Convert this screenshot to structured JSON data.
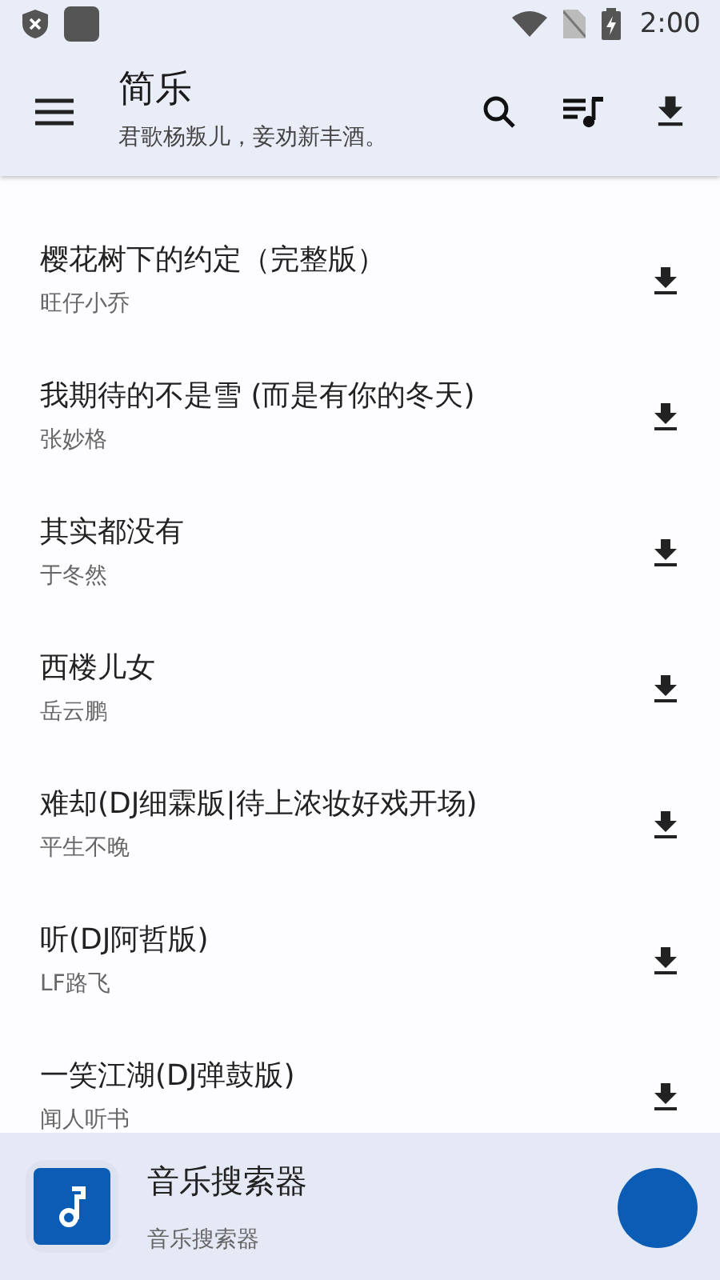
{
  "status_bar": {
    "time": "2:00"
  },
  "app_bar": {
    "title": "简乐",
    "subtitle": "君歌杨叛儿，妾劝新丰酒。"
  },
  "songs": [
    {
      "title": "樱花树下的约定（完整版）",
      "artist": "旺仔小乔"
    },
    {
      "title": "我期待的不是雪 (而是有你的冬天)",
      "artist": "张妙格"
    },
    {
      "title": "其实都没有",
      "artist": "于冬然"
    },
    {
      "title": "西楼儿女",
      "artist": "岳云鹏"
    },
    {
      "title": "难却(DJ细霖版|待上浓妆好戏开场)",
      "artist": "平生不晚"
    },
    {
      "title": "听(DJ阿哲版)",
      "artist": "LF路飞"
    },
    {
      "title": "一笑江湖(DJ弹鼓版)",
      "artist": "闻人听书"
    }
  ],
  "player": {
    "title": "音乐搜索器",
    "subtitle": "音乐搜索器"
  }
}
